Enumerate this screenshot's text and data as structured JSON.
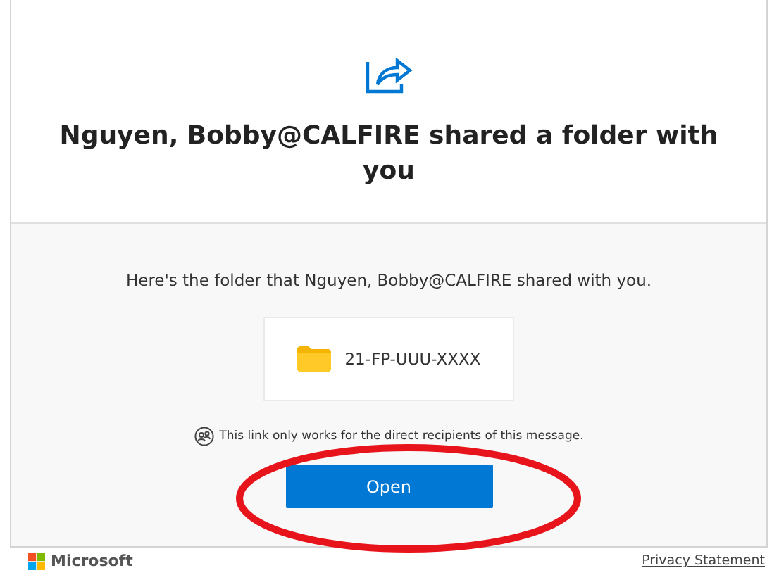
{
  "header": {
    "title": "Nguyen, Bobby@CALFIRE shared a folder with you"
  },
  "body": {
    "message": "Here's the folder that Nguyen, Bobby@CALFIRE shared with you.",
    "folder": {
      "name": "21-FP-UUU-XXXX"
    },
    "notice": "This link only works for the direct recipients of this message.",
    "button": "Open"
  },
  "footer": {
    "brand": "Microsoft",
    "link": "Privacy Statement"
  }
}
